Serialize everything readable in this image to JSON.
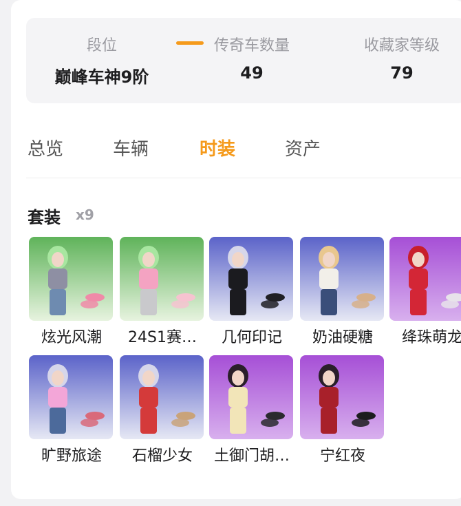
{
  "stats": [
    {
      "label": "段位",
      "value": "巅峰车神9阶"
    },
    {
      "label": "传奇车数量",
      "value": "49"
    },
    {
      "label": "收藏家等级",
      "value": "79"
    }
  ],
  "tabs": [
    {
      "label": "总览",
      "active": false
    },
    {
      "label": "车辆",
      "active": false
    },
    {
      "label": "时装",
      "active": true
    },
    {
      "label": "资产",
      "active": false
    }
  ],
  "accent_color": "#f59a1b",
  "section": {
    "title": "套装",
    "count": "x9"
  },
  "outfits": [
    {
      "name": "炫光风潮",
      "bg": "green",
      "hair": "#a8e6a0",
      "top": "#8e8fa3",
      "bottom": "#6e8bb0",
      "shoe": "#f08aa8"
    },
    {
      "name": "24S1赛…",
      "bg": "green",
      "hair": "#a8e6a0",
      "top": "#f4a3c2",
      "bottom": "#c9c9cc",
      "shoe": "#f6c3d0"
    },
    {
      "name": "几何印记",
      "bg": "blue",
      "hair": "#d6d6ea",
      "top": "#1b1b1f",
      "bottom": "#1b1b1f",
      "shoe": "#202024"
    },
    {
      "name": "奶油硬糖",
      "bg": "blue",
      "hair": "#e9c78f",
      "top": "#f2efe9",
      "bottom": "#3a4e7a",
      "shoe": "#d7b08a"
    },
    {
      "name": "绛珠萌龙",
      "bg": "purple",
      "hair": "#c81e2b",
      "top": "#d32636",
      "bottom": "#d32636",
      "shoe": "#e8e3ea"
    },
    {
      "name": "旷野旅途",
      "bg": "blue",
      "hair": "#d6d6ea",
      "top": "#f3a6d8",
      "bottom": "#4c6a9b",
      "shoe": "#d96a7a"
    },
    {
      "name": "石榴少女",
      "bg": "blue",
      "hair": "#d6d6ea",
      "top": "#d43a3a",
      "bottom": "#d43a3a",
      "shoe": "#c9a37a"
    },
    {
      "name": "土御门胡…",
      "bg": "purple",
      "hair": "#2a1f2a",
      "top": "#f2e5b8",
      "bottom": "#f2e5b8",
      "shoe": "#2a2a2e"
    },
    {
      "name": "宁红夜",
      "bg": "purple",
      "hair": "#2a1f2a",
      "top": "#a8202a",
      "bottom": "#a8202a",
      "shoe": "#1c1c1e"
    }
  ]
}
